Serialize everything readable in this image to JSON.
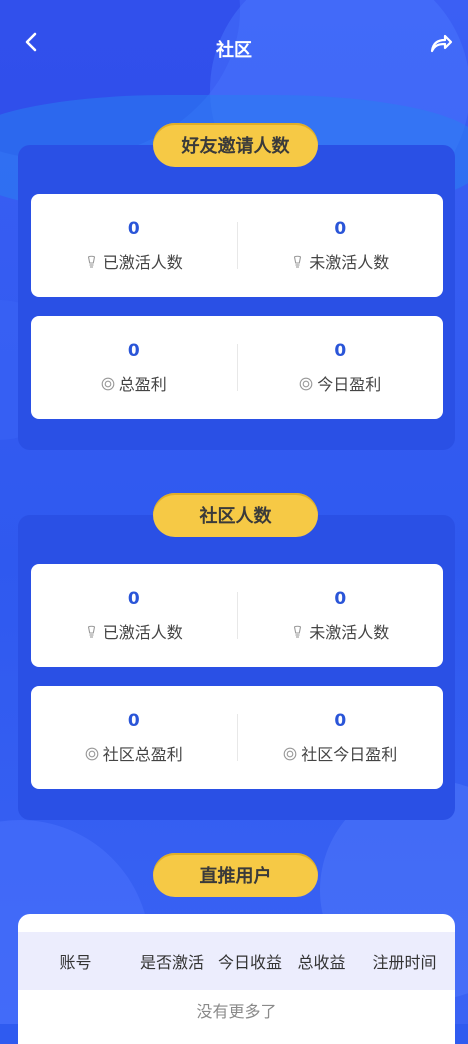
{
  "header": {
    "title": "社区",
    "back_icon": "chevron-left-icon",
    "share_icon": "share-arrow-icon"
  },
  "friend_invites": {
    "title": "好友邀请人数",
    "activated": {
      "value": "0",
      "label": "已激活人数",
      "icon": "bulb-icon"
    },
    "not_activated": {
      "value": "0",
      "label": "未激活人数",
      "icon": "bulb-icon"
    },
    "total_profit": {
      "value": "0",
      "label": "总盈利",
      "icon": "target-icon"
    },
    "today_profit": {
      "value": "0",
      "label": "今日盈利",
      "icon": "target-icon"
    }
  },
  "community": {
    "title": "社区人数",
    "activated": {
      "value": "0",
      "label": "已激活人数",
      "icon": "bulb-icon"
    },
    "not_activated": {
      "value": "0",
      "label": "未激活人数",
      "icon": "bulb-icon"
    },
    "total_profit": {
      "value": "0",
      "label": "社区总盈利",
      "icon": "target-icon"
    },
    "today_profit": {
      "value": "0",
      "label": "社区今日盈利",
      "icon": "target-icon"
    }
  },
  "direct_users": {
    "title": "直推用户",
    "columns": [
      "账号",
      "是否激活",
      "今日收益",
      "总收益",
      "注册时间"
    ],
    "empty_text": "没有更多了"
  },
  "colors": {
    "background": "#2f5bf0",
    "panel": "#2a50e5",
    "pill": "#f6c945",
    "value": "#2a55d8",
    "table_header": "#ecedfd"
  }
}
